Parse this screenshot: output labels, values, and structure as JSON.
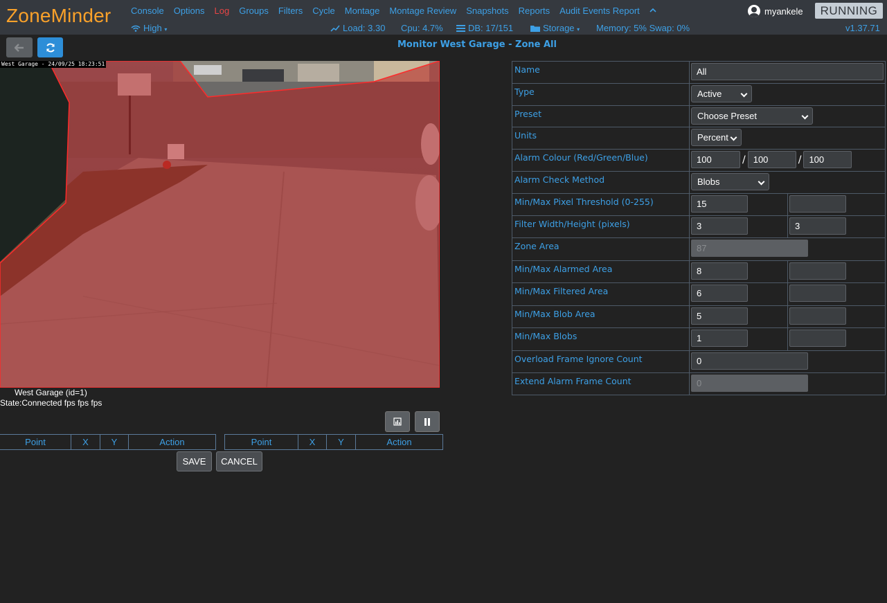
{
  "navbar": {
    "brand": "ZoneMinder",
    "menu": [
      "Console",
      "Options",
      "Log",
      "Groups",
      "Filters",
      "Cycle",
      "Montage",
      "Montage Review",
      "Snapshots",
      "Reports",
      "Audit Events Report"
    ],
    "collapse_icon": "caret-up-icon",
    "username": "myankele",
    "state": "RUNNING",
    "bandwidth": "High",
    "load": "Load: 3.30",
    "cpu": "Cpu: 4.7%",
    "db": "DB: 17/151",
    "storage": "Storage",
    "memory": "Memory: 5% Swap: 0%",
    "version": "v1.37.71"
  },
  "page": {
    "title": "Monitor West Garage - Zone All"
  },
  "monitor": {
    "timestamp": "West Garage - 24/09/25 18:23:51",
    "name": "West Garage (id=1)",
    "state": "State:Connected fps fps fps"
  },
  "points_tables": {
    "headers": [
      "Point",
      "X",
      "Y",
      "Action"
    ]
  },
  "actions": {
    "save": "SAVE",
    "cancel": "CANCEL"
  },
  "zone": {
    "rows": [
      {
        "label": "Name",
        "value": "All"
      },
      {
        "label": "Type",
        "value": "Active"
      },
      {
        "label": "Preset",
        "value": "Choose Preset"
      },
      {
        "label": "Units",
        "value": "Percent"
      },
      {
        "label": "Alarm Colour (Red/Green/Blue)",
        "r": "100",
        "g": "100",
        "b": "100"
      },
      {
        "label": "Alarm Check Method",
        "value": "Blobs"
      },
      {
        "label": "Min/Max Pixel Threshold (0-255)",
        "min": "15",
        "max": ""
      },
      {
        "label": "Filter Width/Height (pixels)",
        "min": "3",
        "max": "3"
      },
      {
        "label": "Zone Area",
        "value": "87"
      },
      {
        "label": "Min/Max Alarmed Area",
        "min": "8",
        "max": ""
      },
      {
        "label": "Min/Max Filtered Area",
        "min": "6",
        "max": ""
      },
      {
        "label": "Min/Max Blob Area",
        "min": "5",
        "max": ""
      },
      {
        "label": "Min/Max Blobs",
        "min": "1",
        "max": ""
      },
      {
        "label": "Overload Frame Ignore Count",
        "value": "0"
      },
      {
        "label": "Extend Alarm Frame Count",
        "value": "0"
      }
    ]
  },
  "colors": {
    "accent": "#3da0e6",
    "brand": "#f9a12a",
    "log": "#e64545",
    "navbar_bg": "#35393f",
    "page_bg": "#222222",
    "zone_overlay": "#b41e1e"
  }
}
